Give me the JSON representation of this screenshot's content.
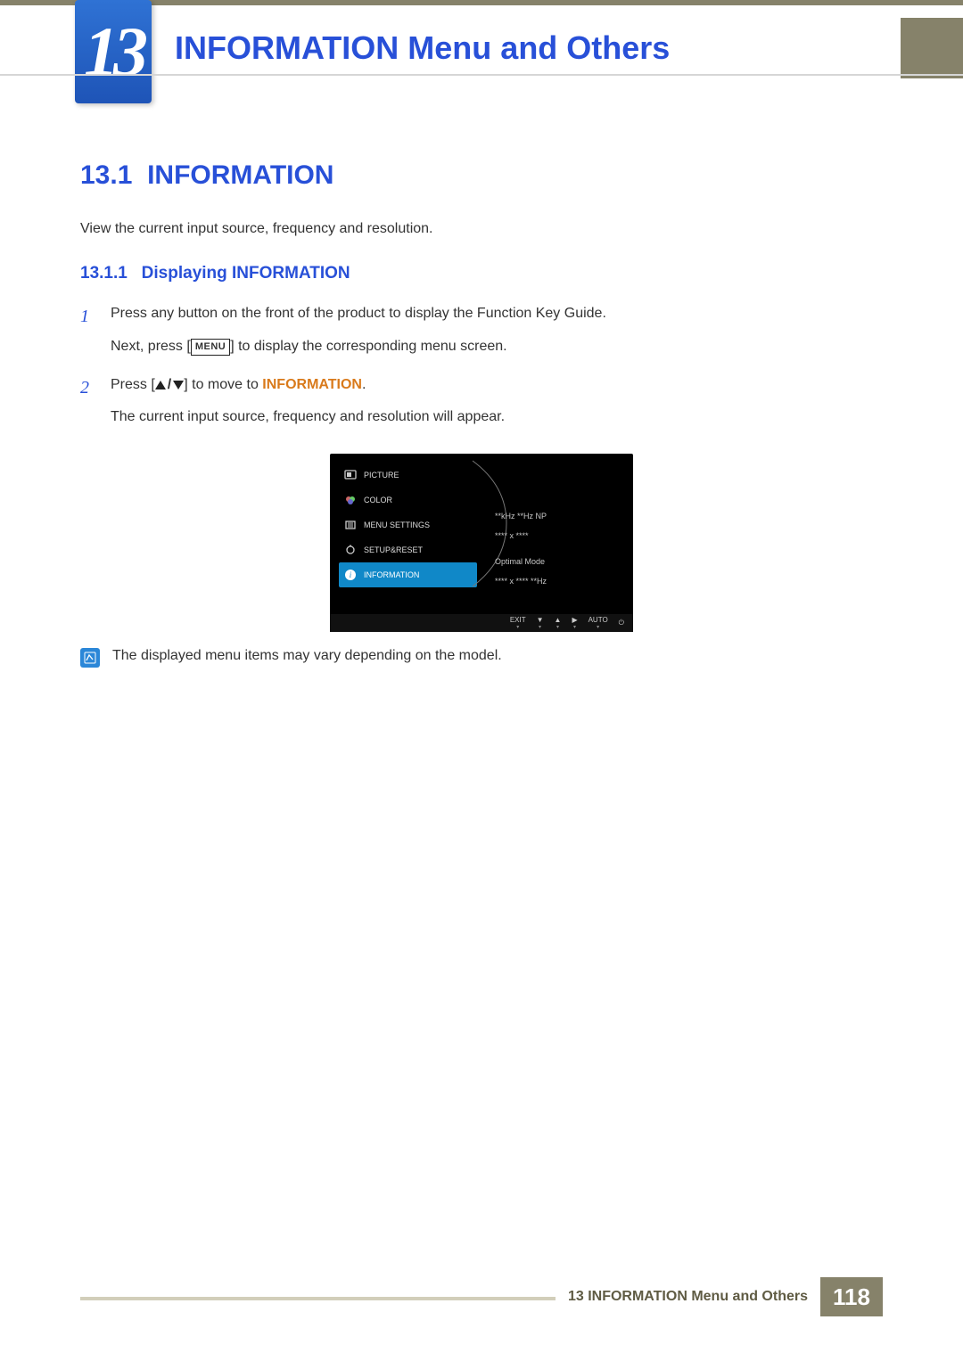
{
  "chapter_number": "13",
  "chapter_title": "INFORMATION Menu and Others",
  "section": {
    "number": "13.1",
    "title": "INFORMATION",
    "intro": "View the current input source, frequency and resolution."
  },
  "subsection": {
    "number": "13.1.1",
    "title": "Displaying INFORMATION"
  },
  "steps": [
    {
      "num": "1",
      "line1_a": "Press any button on the front of the product to display the Function Key Guide.",
      "line2_a": "Next, press [",
      "menu_label": "MENU",
      "line2_b": "] to display the corresponding menu screen."
    },
    {
      "num": "2",
      "line1_a": "Press [",
      "line1_b": "] to move to ",
      "target": "INFORMATION",
      "period": ".",
      "line2": "The current input source, frequency and resolution will appear."
    }
  ],
  "osd": {
    "menu_items": [
      "PICTURE",
      "COLOR",
      "MENU SETTINGS",
      "SETUP&RESET",
      "INFORMATION"
    ],
    "active_index": 4,
    "info_lines": [
      "**kHz **Hz NP",
      "**** x ****",
      "Optimal Mode",
      "**** x **** **Hz"
    ],
    "footer": {
      "exit": "EXIT",
      "auto": "AUTO"
    }
  },
  "note": "The displayed menu items may vary depending on the model.",
  "footer": {
    "label_prefix": "13",
    "label_text": "INFORMATION Menu and Others",
    "page": "118"
  }
}
